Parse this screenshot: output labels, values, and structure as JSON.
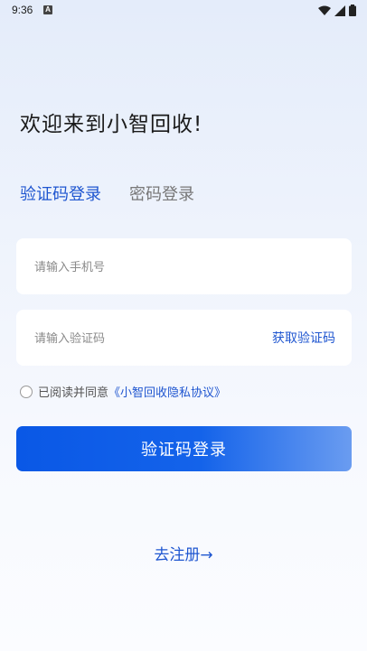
{
  "status_bar": {
    "time": "9:36",
    "notification_badge": "A",
    "icons": [
      "wifi-icon",
      "signal-icon",
      "battery-icon"
    ]
  },
  "welcome_title": "欢迎来到小智回收!",
  "tabs": [
    {
      "label": "验证码登录",
      "active": true
    },
    {
      "label": "密码登录",
      "active": false
    }
  ],
  "phone_field": {
    "placeholder": "请输入手机号",
    "value": ""
  },
  "code_field": {
    "placeholder": "请输入验证码",
    "value": "",
    "get_code_label": "获取验证码"
  },
  "agreement": {
    "prefix": "已阅读并同意",
    "link": "《小智回收隐私协议》",
    "checked": false
  },
  "login_button": "验证码登录",
  "register_link": "去注册→",
  "colors": {
    "accent": "#1f56d0",
    "button_start": "#0a58e6",
    "button_end": "#6a9cf0"
  }
}
